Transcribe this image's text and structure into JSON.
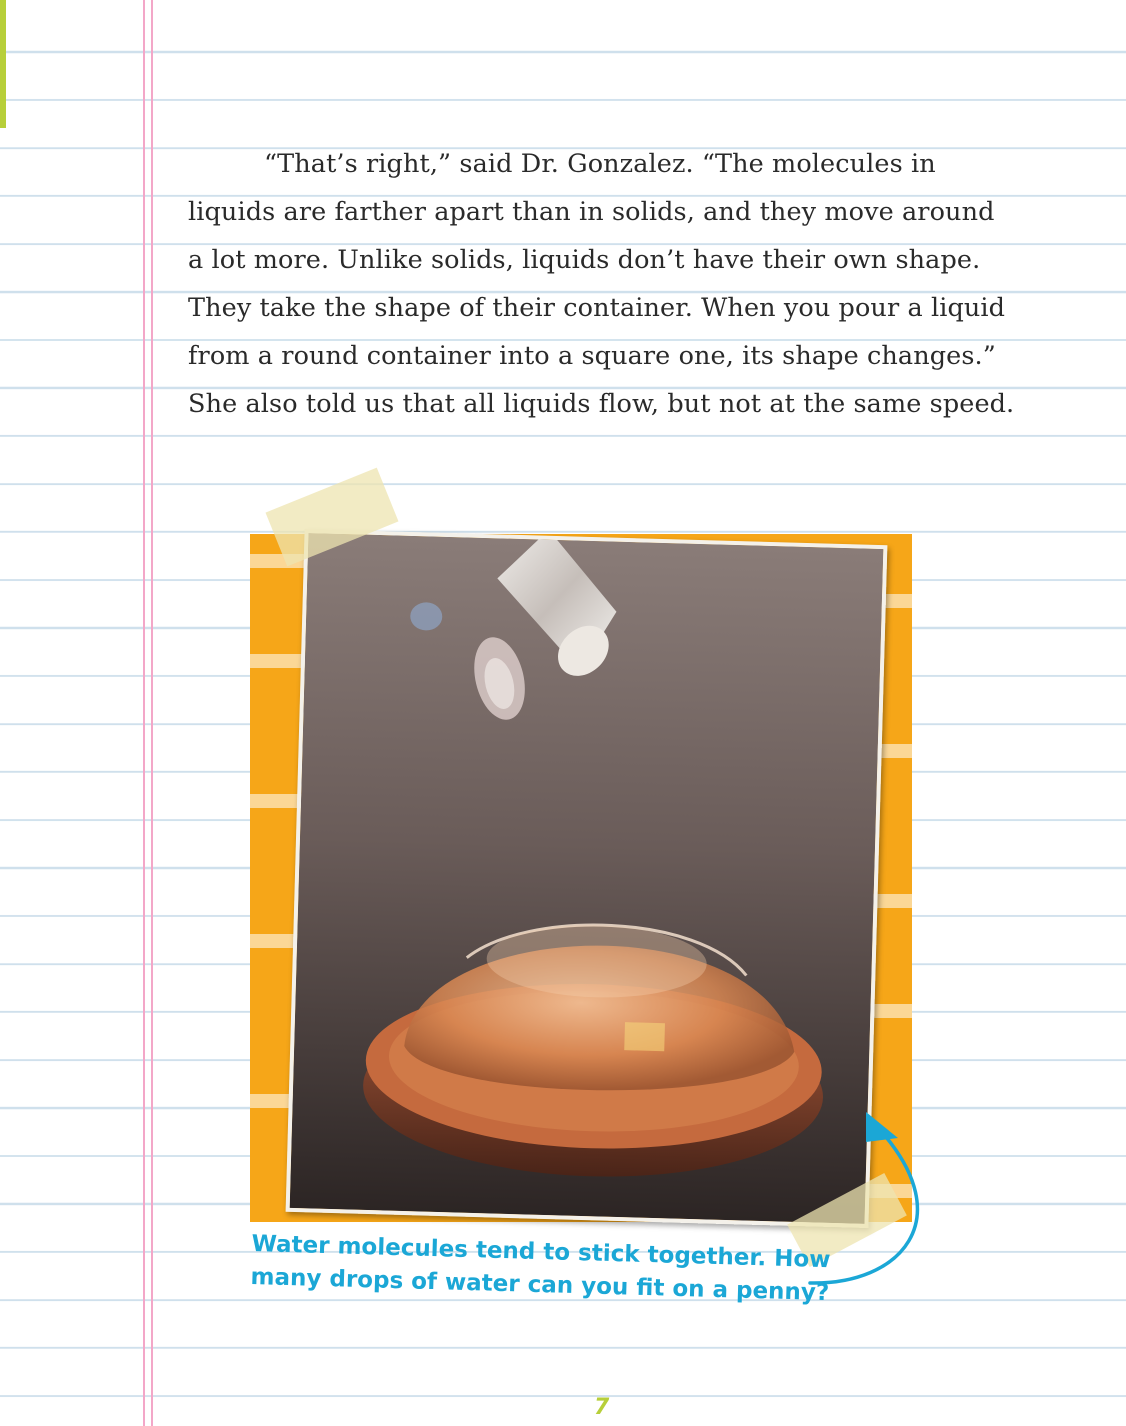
{
  "body_text": "“That’s right,” said Dr. Gonzalez. “The molecules in liquids are farther apart than in solids, and they move around a lot more. Unlike solids, liquids don’t have their own shape. They take the shape of their container. When you pour a liquid from a round container into a square one, its shape changes.” She also told us that all liquids flow, but not at the same speed.",
  "photo": {
    "description_icon": "water-drop-on-penny-photo"
  },
  "caption": "Water molecules tend to stick together. How many drops of water can you fit on a penny?",
  "page_number": "7",
  "colors": {
    "caption": "#1ba7d6",
    "panel": "#f6a618",
    "margin_line": "#f3a7c8",
    "ruled_line": "#cfe0ec",
    "page_number": "#b7cf3a"
  }
}
